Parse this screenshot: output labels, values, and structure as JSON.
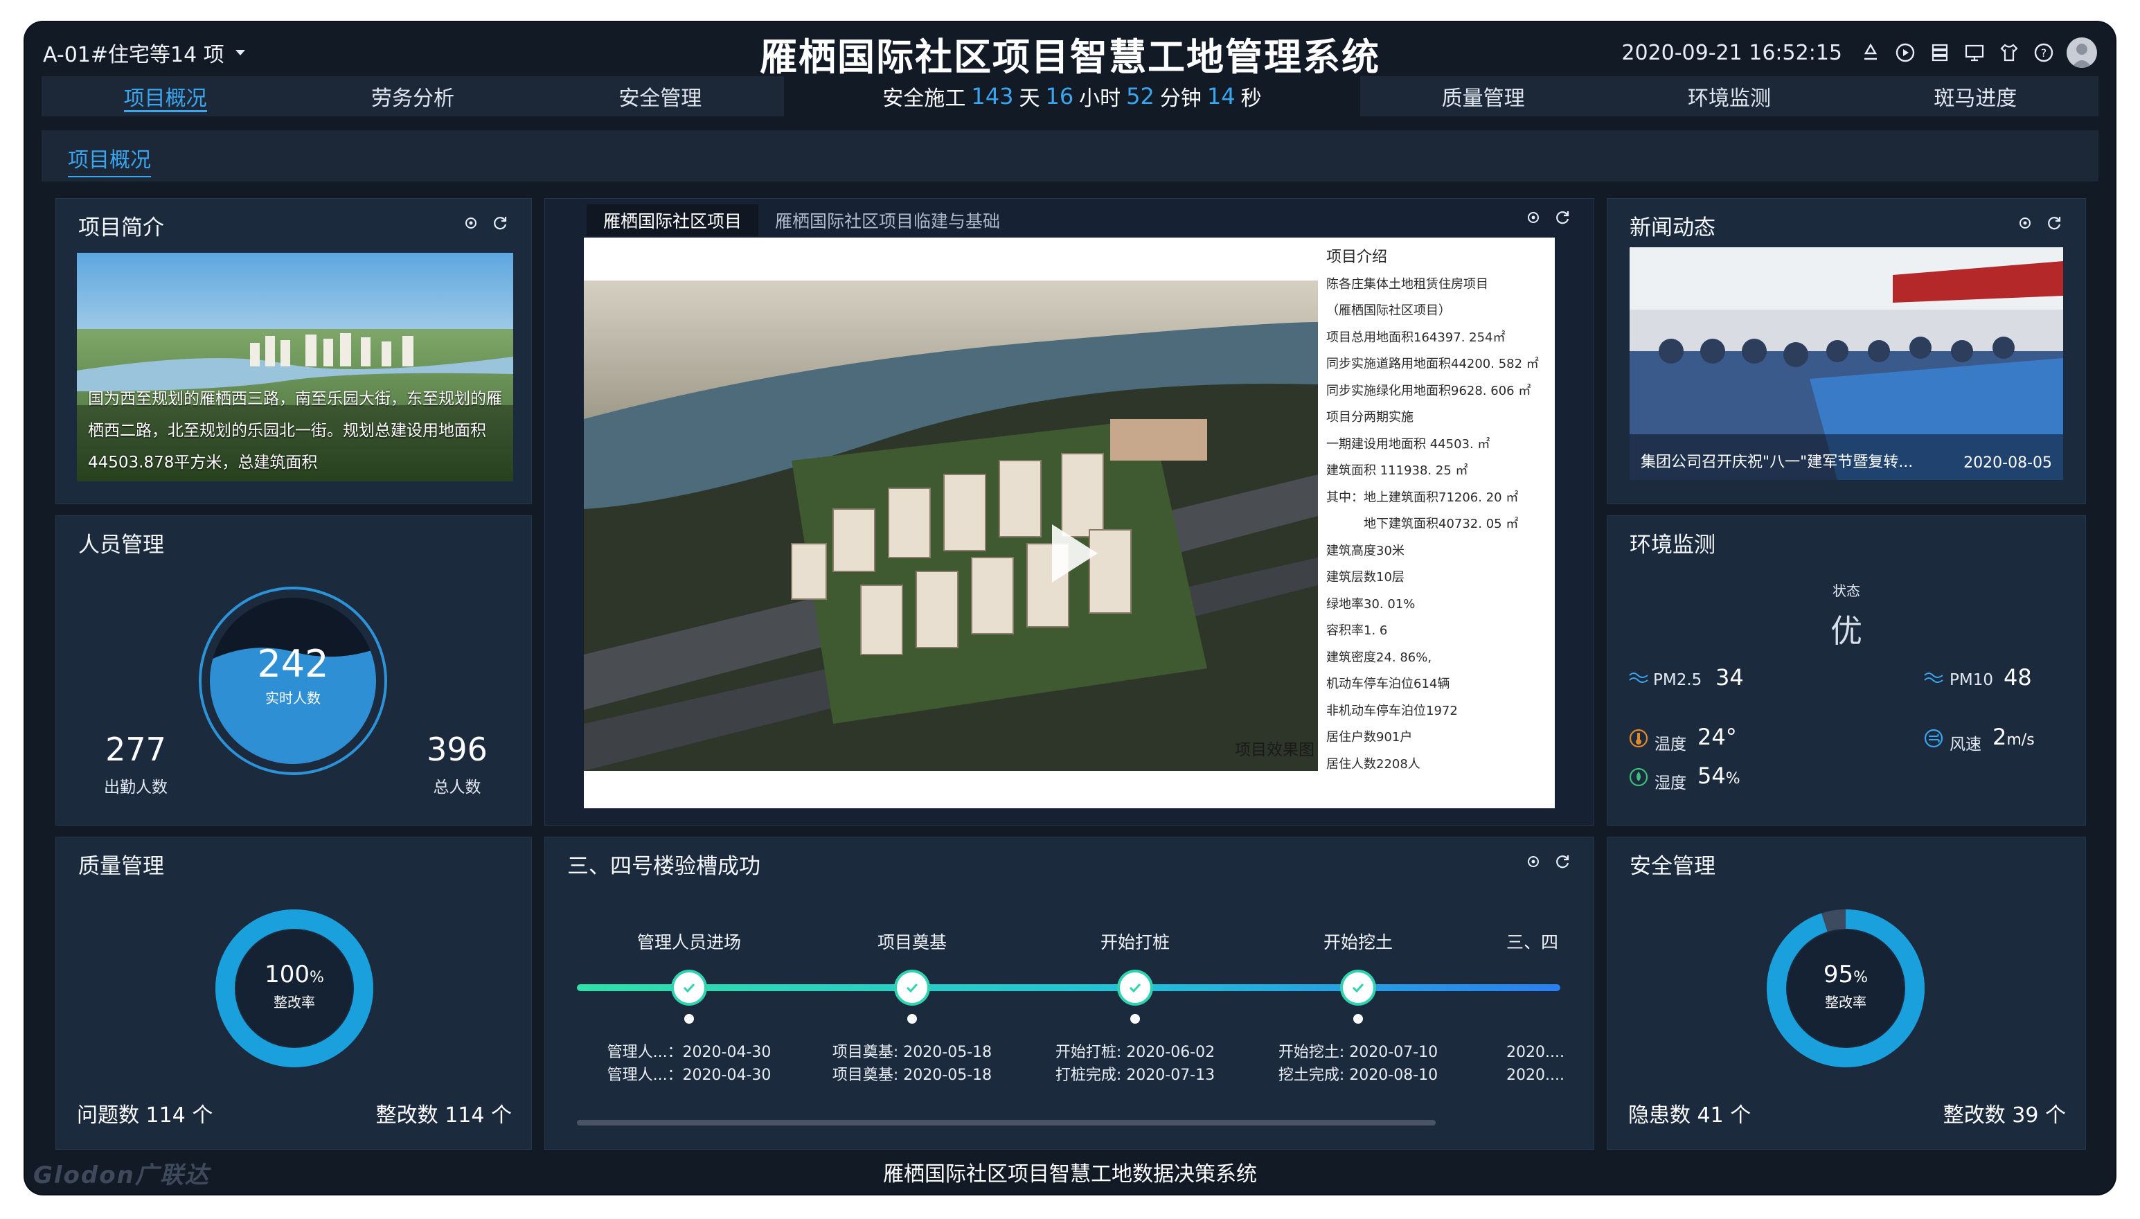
{
  "header": {
    "project_selector": "A-01#住宅等14 项",
    "title": "雁栖国际社区项目智慧工地管理系统",
    "datetime": "2020-09-21 16:52:15"
  },
  "nav": {
    "left": [
      "项目概况",
      "劳务分析",
      "安全管理"
    ],
    "right": [
      "质量管理",
      "环境监测",
      "斑马进度"
    ],
    "safety_run": {
      "prefix": "安全施工",
      "days": "143",
      "days_unit": "天",
      "hours": "16",
      "hours_unit": "小时",
      "minutes": "52",
      "minutes_unit": "分钟",
      "seconds": "14",
      "seconds_unit": "秒"
    }
  },
  "subnav": {
    "active": "项目概况"
  },
  "project_intro": {
    "title": "项目简介",
    "text": "国为西至规划的雁栖西三路，南至乐园大街，东至规划的雁栖西二路，北至规划的乐园北一街。规划总建设用地面积44503.878平方米，总建筑面积"
  },
  "personnel": {
    "title": "人员管理",
    "realtime": "242",
    "realtime_label": "实时人数",
    "attendance": "277",
    "attendance_label": "出勤人数",
    "total": "396",
    "total_label": "总人数"
  },
  "video_panel": {
    "tabs": [
      "雁栖国际社区项目",
      "雁栖国际社区项目临建与基础"
    ],
    "render_caption": "项目效果图",
    "spec_title": "项目介绍",
    "spec_lines": [
      "陈各庄集体土地租赁住房项目",
      "（雁栖国际社区项目）",
      "项目总用地面积164397. 254㎡",
      "同步实施道路用地面积44200. 582 ㎡",
      "同步实施绿化用地面积9628. 606 ㎡",
      "项目分两期实施",
      "一期建设用地面积  44503.   ㎡",
      "建筑面积  111938. 25  ㎡",
      "其中：地上建筑面积71206. 20  ㎡",
      "　　　地下建筑面积40732. 05  ㎡",
      "建筑高度30米",
      "建筑层数10层",
      "绿地率30.  01%",
      "容积率1. 6",
      "建筑密度24. 86%,",
      "机动车停车泊位614辆",
      "非机动车停车泊位1972",
      "居住户数901户",
      "居住人数2208人"
    ]
  },
  "news": {
    "title": "新闻动态",
    "caption": "集团公司召开庆祝\"八一\"建军节暨复转...",
    "date": "2020-08-05"
  },
  "environment": {
    "title": "环境监测",
    "status_label": "状态",
    "status_value": "优",
    "pm25_label": "PM2.5",
    "pm25_value": "34",
    "pm10_label": "PM10",
    "pm10_value": "48",
    "temp_label": "温度",
    "temp_value": "24°",
    "wind_label": "风速",
    "wind_value": "2",
    "wind_unit": "m/s",
    "humidity_label": "湿度",
    "humidity_value": "54",
    "humidity_unit": "%"
  },
  "quality": {
    "title": "质量管理",
    "rate": "100",
    "rate_unit": "%",
    "rate_label": "整改率",
    "rate_fraction": 1.0,
    "issues_label": "问题数",
    "issues_value": "114",
    "issues_unit": "个",
    "fixed_label": "整改数",
    "fixed_value": "114",
    "fixed_unit": "个"
  },
  "milestones": {
    "title": "三、四号楼验槽成功",
    "items": [
      {
        "name": "管理人员进场",
        "line1": "管理人...：2020-04-30",
        "line2": "管理人...：2020-04-30",
        "done": true
      },
      {
        "name": "项目奠基",
        "line1": "项目奠基: 2020-05-18",
        "line2": "项目奠基: 2020-05-18",
        "done": true
      },
      {
        "name": "开始打桩",
        "line1": "开始打桩: 2020-06-02",
        "line2": "打桩完成: 2020-07-13",
        "done": true
      },
      {
        "name": "开始挖土",
        "line1": "开始挖土: 2020-07-10",
        "line2": "挖土完成: 2020-08-10",
        "done": true
      },
      {
        "name": "三、四",
        "line1": "2020....",
        "line2": "2020....",
        "done": false
      }
    ]
  },
  "safety": {
    "title": "安全管理",
    "rate": "95",
    "rate_unit": "%",
    "rate_label": "整改率",
    "rate_fraction": 0.95,
    "hazards_label": "隐患数",
    "hazards_value": "41",
    "hazards_unit": "个",
    "fixed_label": "整改数",
    "fixed_value": "39",
    "fixed_unit": "个"
  },
  "footer": {
    "text": "雁栖国际社区项目智慧工地数据决策系统",
    "logo": "Glodon广联达"
  },
  "colors": {
    "accent": "#3aa6f0",
    "panel": "#1c2a3e",
    "ring": "#1aa0dc",
    "timeline": "#2fd3b0"
  }
}
